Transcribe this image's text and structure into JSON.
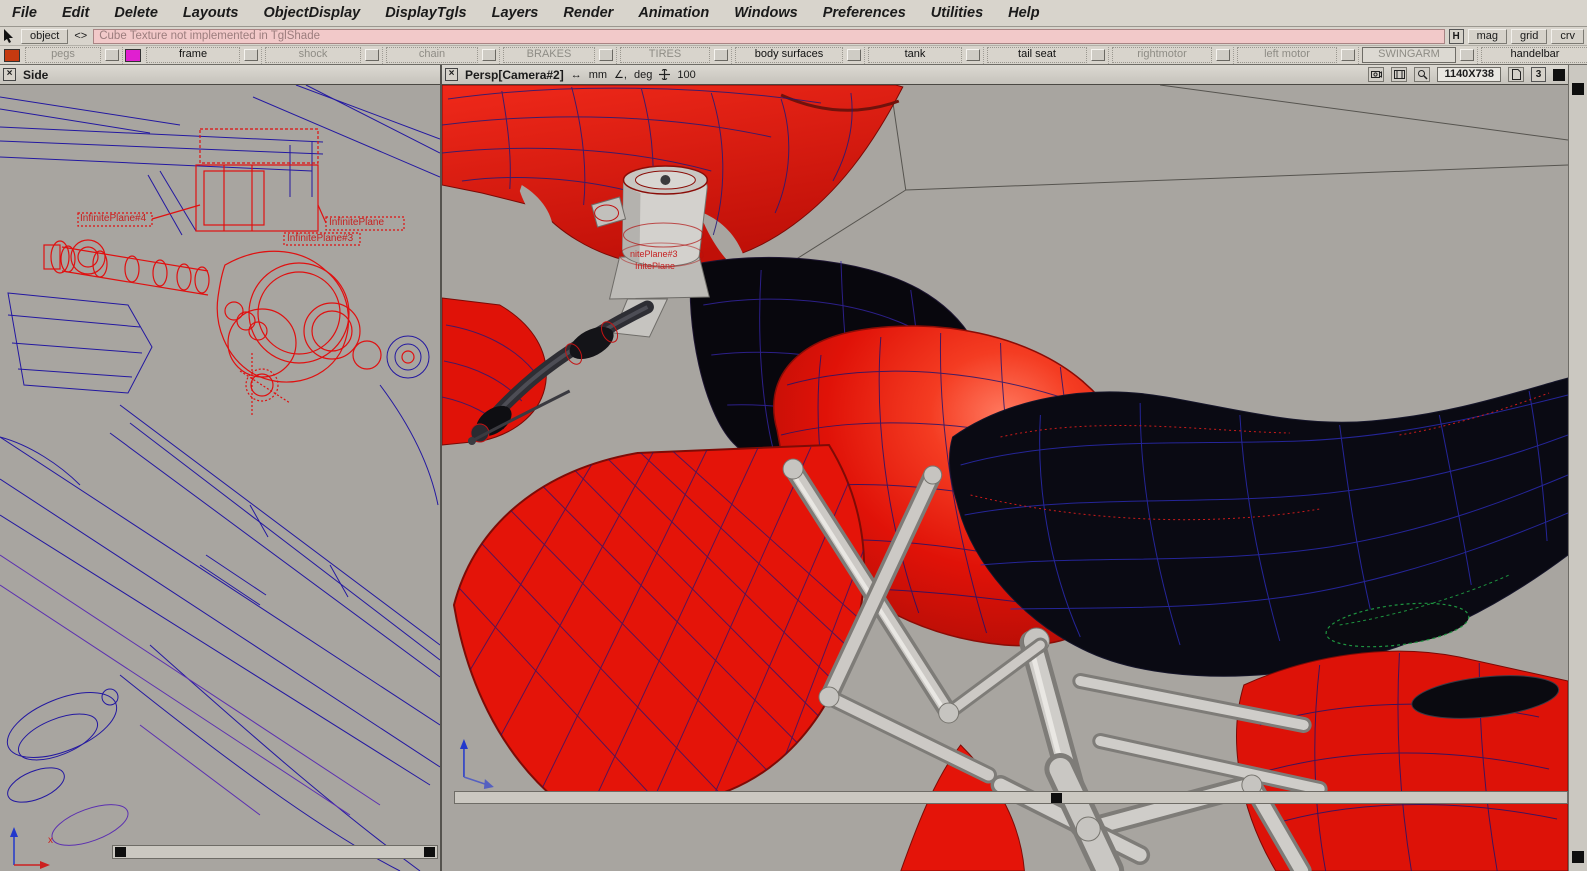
{
  "menubar": {
    "items": [
      {
        "label": "File"
      },
      {
        "label": "Edit"
      },
      {
        "label": "Delete"
      },
      {
        "label": "Layouts"
      },
      {
        "label": "ObjectDisplay"
      },
      {
        "label": "DisplayTgls"
      },
      {
        "label": "Layers"
      },
      {
        "label": "Render"
      },
      {
        "label": "Animation"
      },
      {
        "label": "Windows"
      },
      {
        "label": "Preferences"
      },
      {
        "label": "Utilities"
      },
      {
        "label": "Help"
      }
    ]
  },
  "toolbar": {
    "object_label": "object",
    "swap_label": "<>",
    "message": "Cube Texture not implemented in TglShade",
    "h_label": "H",
    "mag_label": "mag",
    "grid_label": "grid",
    "crv_label": "crv"
  },
  "layers": {
    "items": [
      {
        "label": "pegs",
        "state": "hidden"
      },
      {
        "label": "frame",
        "state": "visible"
      },
      {
        "label": "shock",
        "state": "hidden"
      },
      {
        "label": "chain",
        "state": "hidden"
      },
      {
        "label": "BRAKES",
        "state": "hidden"
      },
      {
        "label": "TIRES",
        "state": "hidden"
      },
      {
        "label": "body surfaces",
        "state": "visible"
      },
      {
        "label": "tank",
        "state": "visible"
      },
      {
        "label": "tail seat",
        "state": "visible"
      },
      {
        "label": "rightmotor",
        "state": "hidden"
      },
      {
        "label": "left motor",
        "state": "hidden"
      },
      {
        "label": "SWINGARM",
        "state": "selected"
      },
      {
        "label": "handelbar",
        "state": "visible"
      }
    ],
    "swatches": {
      "first": "#c63a10",
      "second": "#e01fd0"
    },
    "nav_prev": "◁",
    "nav_next": "▷"
  },
  "viewports": {
    "close_glyph": "×",
    "side": {
      "title": "Side",
      "labels": [
        {
          "text": "InfinitePlane#4"
        },
        {
          "text": "InfinitePlane#3"
        },
        {
          "text": "InfinitePlane"
        }
      ],
      "axis_x": "x"
    },
    "persp": {
      "title": "Persp[Camera#2]",
      "unit_arrow": "↔",
      "unit": "mm",
      "angle_icon": "∠,",
      "angle_unit": "deg",
      "snap_value": "100",
      "resolution": "1140X738",
      "frame_number": "3",
      "labels": [
        {
          "text": "nitePlane#3"
        },
        {
          "text": "InitePlane"
        }
      ]
    }
  },
  "colors": {
    "chrome": "#d6d2ca",
    "viewport_bg": "#a8a5a0",
    "body_red": "#e01208",
    "wire_blue": "#231a78",
    "message_bg": "#f2c9c9"
  }
}
